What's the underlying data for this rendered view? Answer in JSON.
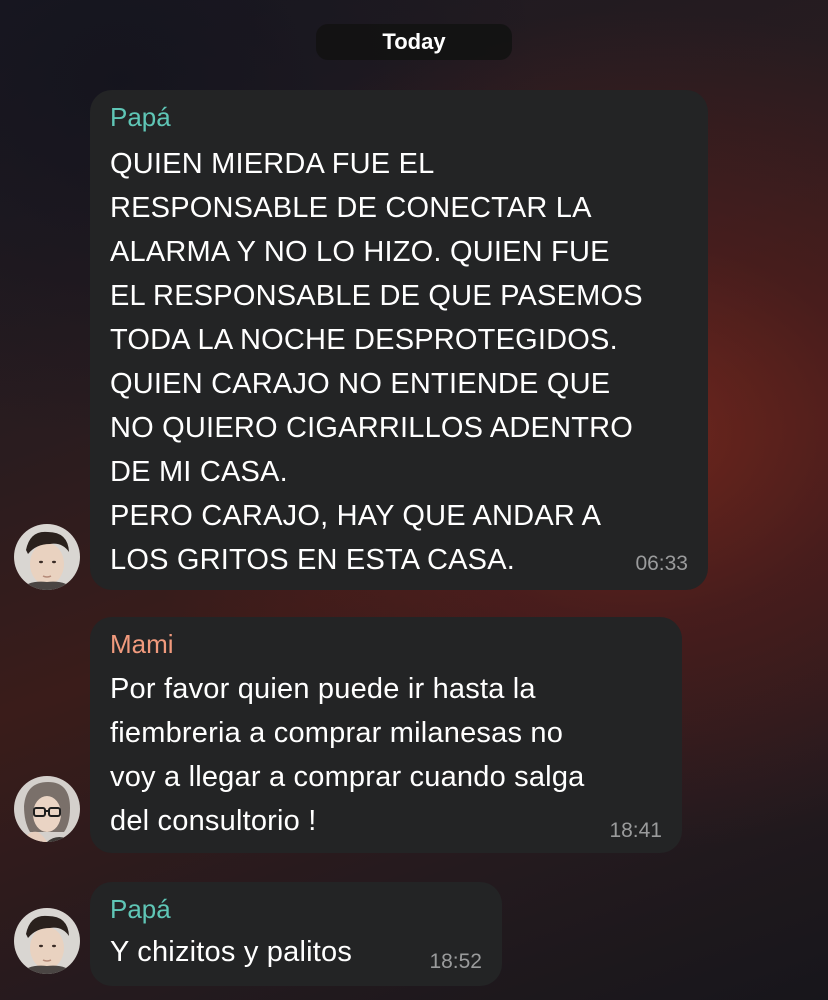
{
  "date_separator": "Today",
  "colors": {
    "papa_name": "#5fc6b6",
    "mami_name": "#f19a7d",
    "bubble_bg": "#232425",
    "time_text": "#9a9b9c"
  },
  "messages": [
    {
      "sender": "Papá",
      "text": "QUIEN MIERDA FUE EL\nRESPONSABLE DE CONECTAR LA\nALARMA Y NO LO HIZO. QUIEN FUE\nEL RESPONSABLE DE QUE PASEMOS\nTODA LA NOCHE DESPROTEGIDOS.\nQUIEN CARAJO NO ENTIENDE QUE\nNO QUIERO CIGARRILLOS ADENTRO\nDE MI CASA.\nPERO CARAJO, HAY QUE ANDAR A\nLOS GRITOS EN ESTA CASA.",
      "time": "06:33",
      "avatar": "papa-avatar-photo"
    },
    {
      "sender": "Mami",
      "text": "Por favor quien puede ir hasta la\nfiembreria a comprar milanesas no\nvoy a llegar a comprar cuando salga\ndel consultorio !",
      "time": "18:41",
      "avatar": "mami-avatar-photo"
    },
    {
      "sender": "Papá",
      "text": "Y chizitos y palitos",
      "time": "18:52",
      "avatar": "papa-avatar-photo"
    }
  ]
}
